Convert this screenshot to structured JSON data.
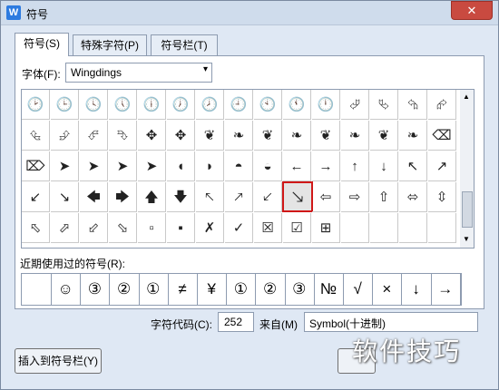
{
  "window": {
    "title": "符号",
    "app_icon_letter": "W",
    "close_symbol": "✕"
  },
  "tabs": [
    {
      "label": "符号(S)"
    },
    {
      "label": "特殊字符(P)"
    },
    {
      "label": "符号栏(T)"
    }
  ],
  "font": {
    "label": "字体(F):",
    "value": "Wingdings",
    "dropdown_arrow": "▾"
  },
  "symbol_grid": {
    "columns": 15,
    "selected_index": 54,
    "cells": [
      "🕑",
      "🕒",
      "🕓",
      "🕔",
      "🕕",
      "🕖",
      "🕗",
      "🕘",
      "🕙",
      "🕚",
      "🕛",
      "⮰",
      "⮱",
      "⮲",
      "⮳",
      "⮴",
      "⮵",
      "⮶",
      "⮷",
      "✥",
      "✥",
      "❦",
      "❧",
      "❦",
      "❧",
      "❦",
      "❧",
      "❦",
      "❧",
      "⌫",
      "⌦",
      "➤",
      "➤",
      "➤",
      "➤",
      "◖",
      "◗",
      "◓",
      "◒",
      "←",
      "→",
      "↑",
      "↓",
      "↖",
      "↗",
      "↙",
      "↘",
      "🡄",
      "🡆",
      "🡅",
      "🡇",
      "🡔",
      "🡕",
      "🡗",
      "🡖",
      "⇦",
      "⇨",
      "⇧",
      "⬄",
      "⇳",
      "⬁",
      "⬀",
      "⬃",
      "⬂",
      "▫",
      "▪",
      "✗",
      "✓",
      "☒",
      "☑",
      "⊞"
    ],
    "scroll_up": "▲",
    "scroll_down": "▼"
  },
  "recent": {
    "label": "近期使用过的符号(R):",
    "symbols": [
      "",
      "☺",
      "③",
      "②",
      "①",
      "≠",
      "¥",
      "①",
      "②",
      "③",
      "№",
      "√",
      "×",
      "↓",
      "→"
    ]
  },
  "char_code": {
    "label": "字符代码(C):",
    "value": "252"
  },
  "from": {
    "label": "来自(M)",
    "value": "Symbol(十进制)"
  },
  "buttons": {
    "insert_to_bar": "插入到符号栏(Y)"
  },
  "watermark": "软件技巧"
}
